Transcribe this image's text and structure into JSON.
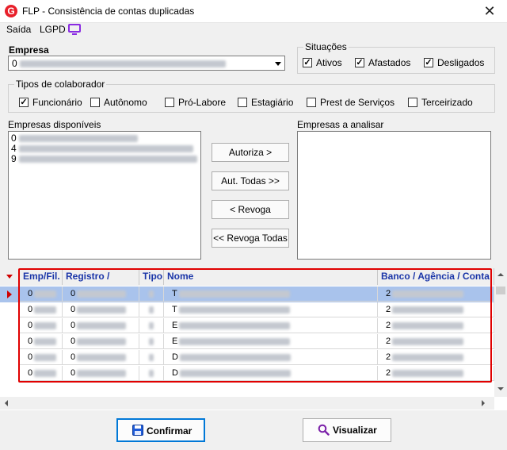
{
  "window": {
    "title": "FLP - Consistência de contas duplicadas",
    "close_glyph": "✕",
    "app_icon_letter": "G"
  },
  "menu": [
    {
      "label": "Saída"
    },
    {
      "label": "LGPD"
    }
  ],
  "empresa": {
    "label": "Empresa",
    "value_prefix": "0"
  },
  "situacoes": {
    "title": "Situações",
    "items": [
      {
        "label": "Ativos",
        "checked": true
      },
      {
        "label": "Afastados",
        "checked": true
      },
      {
        "label": "Desligados",
        "checked": true
      }
    ]
  },
  "tipos": {
    "title": "Tipos de colaborador",
    "items": [
      {
        "label": "Funcionário",
        "checked": true
      },
      {
        "label": "Autônomo",
        "checked": false
      },
      {
        "label": "Pró-Labore",
        "checked": false
      },
      {
        "label": "Estagiário",
        "checked": false
      },
      {
        "label": "Prest de Serviços",
        "checked": false
      },
      {
        "label": "Terceirizado",
        "checked": false
      }
    ]
  },
  "disponiveis": {
    "title": "Empresas disponíveis",
    "rows": [
      "0",
      "4",
      "9"
    ]
  },
  "analisar": {
    "title": "Empresas a analisar"
  },
  "buttons": {
    "autoriza": "Autoriza >",
    "aut_todas": "Aut. Todas >>",
    "revoga": "< Revoga",
    "revoga_todas": "<< Revoga Todas"
  },
  "grid": {
    "columns": [
      "Emp/Fil.",
      "Registro / Chapa",
      "Tipo",
      "Nome",
      "Banco / Agência / Conta"
    ],
    "rows": [
      [
        "0",
        "0",
        "",
        "T",
        "2"
      ],
      [
        "0",
        "0",
        "",
        "T",
        "2"
      ],
      [
        "0",
        "0",
        "",
        "E",
        "2"
      ],
      [
        "0",
        "0",
        "",
        "E",
        "2"
      ],
      [
        "0",
        "0",
        "",
        "D",
        "2"
      ],
      [
        "0",
        "0",
        "",
        "D",
        "2"
      ]
    ]
  },
  "footer": {
    "confirmar": "Confirmar",
    "visualizar": "Visualizar"
  },
  "colors": {
    "header_text": "#1a35a8",
    "highlight": "#e00000",
    "selected_row": "#a9c3ec",
    "lgpd_icon": "#8a2be2"
  }
}
